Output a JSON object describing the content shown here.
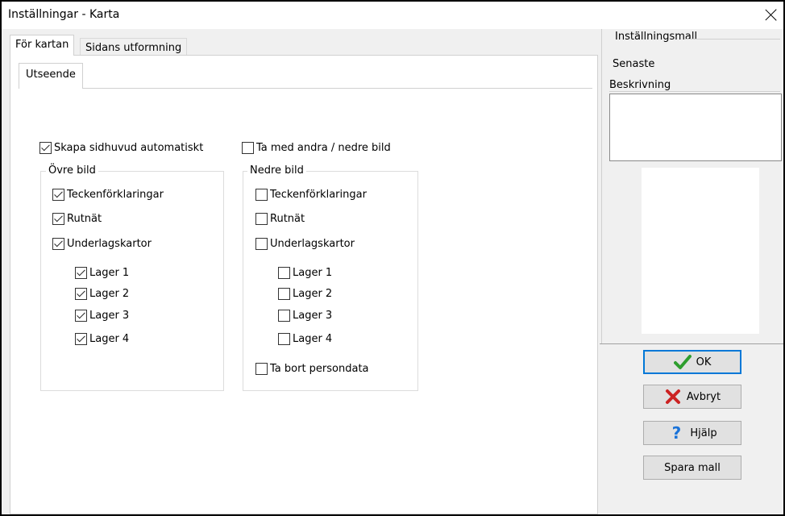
{
  "window": {
    "title": "Inställningar - Karta"
  },
  "tabs": [
    "För kartan",
    "Sidans utformning"
  ],
  "subtab": "Utseende",
  "main": {
    "skapa_sidhuvud": {
      "label": "Skapa sidhuvud automatiskt",
      "checked": true
    },
    "ta_med_andra": {
      "label": "Ta med andra / nedre bild",
      "checked": false
    },
    "ovre_bild": {
      "title": "Övre bild",
      "items": [
        {
          "label": "Teckenförklaringar",
          "checked": true
        },
        {
          "label": "Rutnät",
          "checked": true
        },
        {
          "label": "Underlagskartor",
          "checked": true
        }
      ],
      "layers": [
        {
          "label": "Lager 1",
          "checked": true
        },
        {
          "label": "Lager 2",
          "checked": true
        },
        {
          "label": "Lager 3",
          "checked": true
        },
        {
          "label": "Lager 4",
          "checked": true
        }
      ]
    },
    "nedre_bild": {
      "title": "Nedre bild",
      "items": [
        {
          "label": "Teckenförklaringar",
          "checked": false
        },
        {
          "label": "Rutnät",
          "checked": false
        },
        {
          "label": "Underlagskartor",
          "checked": false
        }
      ],
      "layers": [
        {
          "label": "Lager 1",
          "checked": false
        },
        {
          "label": "Lager 2",
          "checked": false
        },
        {
          "label": "Lager 3",
          "checked": false
        },
        {
          "label": "Lager 4",
          "checked": false
        }
      ],
      "ta_bort": {
        "label": "Ta bort persondata",
        "checked": false
      }
    }
  },
  "sidebar": {
    "template_label": "Inställningsmall",
    "template_value": "Senaste",
    "description_label": "Beskrivning",
    "description_value": ""
  },
  "buttons": {
    "ok": "OK",
    "cancel": "Avbryt",
    "help": "Hjälp",
    "save": "Spara mall"
  },
  "colors": {
    "ok_icon": "#2e9e2e",
    "cancel_icon": "#cc2222",
    "help_icon": "#1a73d9",
    "default_border": "#0078d7"
  },
  "icons": {
    "ok": "checkmark-icon",
    "cancel": "x-icon",
    "help": "question-icon"
  }
}
